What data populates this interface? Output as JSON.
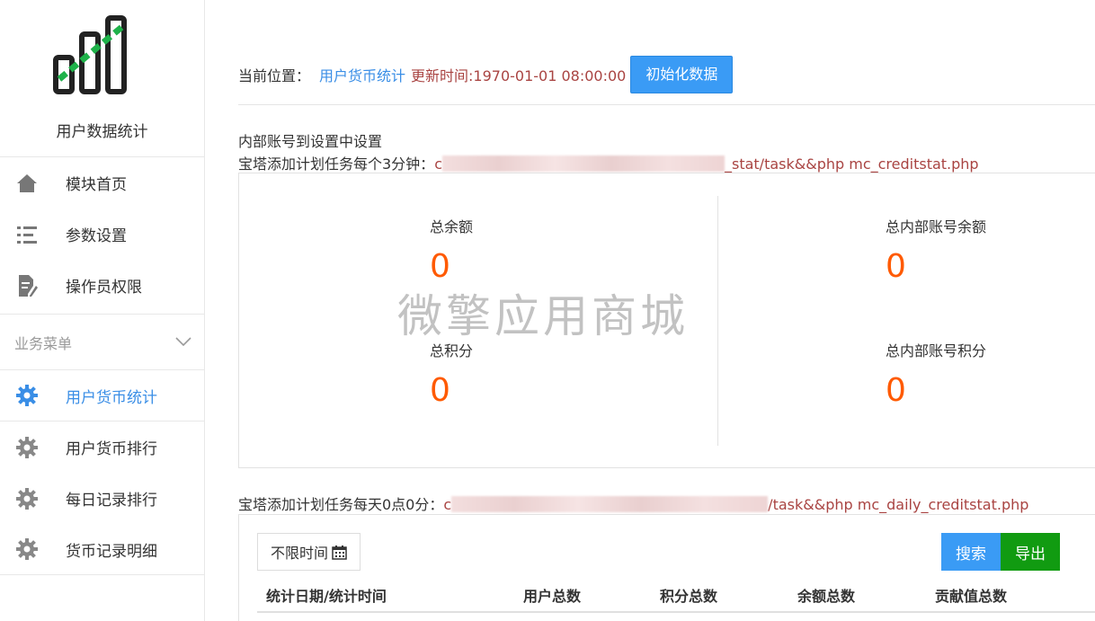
{
  "sidebar": {
    "app_title": "用户数据统计",
    "top_items": [
      {
        "label": "模块首页",
        "icon": "home-icon"
      },
      {
        "label": "参数设置",
        "icon": "list-icon"
      },
      {
        "label": "操作员权限",
        "icon": "document-edit-icon"
      }
    ],
    "group": {
      "label": "业务菜单",
      "icon": "chevron-down-icon"
    },
    "group_items": [
      {
        "label": "用户货币统计",
        "icon": "gear-icon",
        "active": true
      },
      {
        "label": "用户货币排行",
        "icon": "gear-icon"
      },
      {
        "label": "每日记录排行",
        "icon": "gear-icon"
      },
      {
        "label": "货币记录明细",
        "icon": "gear-icon"
      }
    ]
  },
  "breadcrumb": {
    "label": "当前位置：",
    "current": "用户货币统计",
    "update_time": "更新时间:1970-01-01 08:00:00",
    "init_button": "初始化数据"
  },
  "notes": {
    "internal_account": "内部账号到设置中设置",
    "cron_3min_prefix": "宝塔添加计划任务每个3分钟：",
    "cron_3min_start": "c",
    "cron_3min_suffix": "_stat/task&&php mc_creditstat.php",
    "cron_daily_prefix": "宝塔添加计划任务每天0点0分：",
    "cron_daily_start": "c",
    "cron_daily_suffix": "/task&&php mc_daily_creditstat.php"
  },
  "stats": {
    "total_balance": {
      "label": "总余额",
      "value": "0"
    },
    "internal_balance": {
      "label": "总内部账号余额",
      "value": "0"
    },
    "total_points": {
      "label": "总积分",
      "value": "0"
    },
    "internal_points": {
      "label": "总内部账号积分",
      "value": "0"
    }
  },
  "watermark": "微擎应用商城",
  "toolbar": {
    "date_filter": "不限时间",
    "search": "搜索",
    "export": "导出"
  },
  "table": {
    "columns": [
      "统计日期/统计时间",
      "用户总数",
      "积分总数",
      "余额总数",
      "贡献值总数"
    ]
  },
  "colors": {
    "accent": "#3a8ee6",
    "primary_button": "#3a9bf5",
    "export_button": "#119b11",
    "value_orange": "#ff5a00",
    "path_red": "#a94442"
  }
}
